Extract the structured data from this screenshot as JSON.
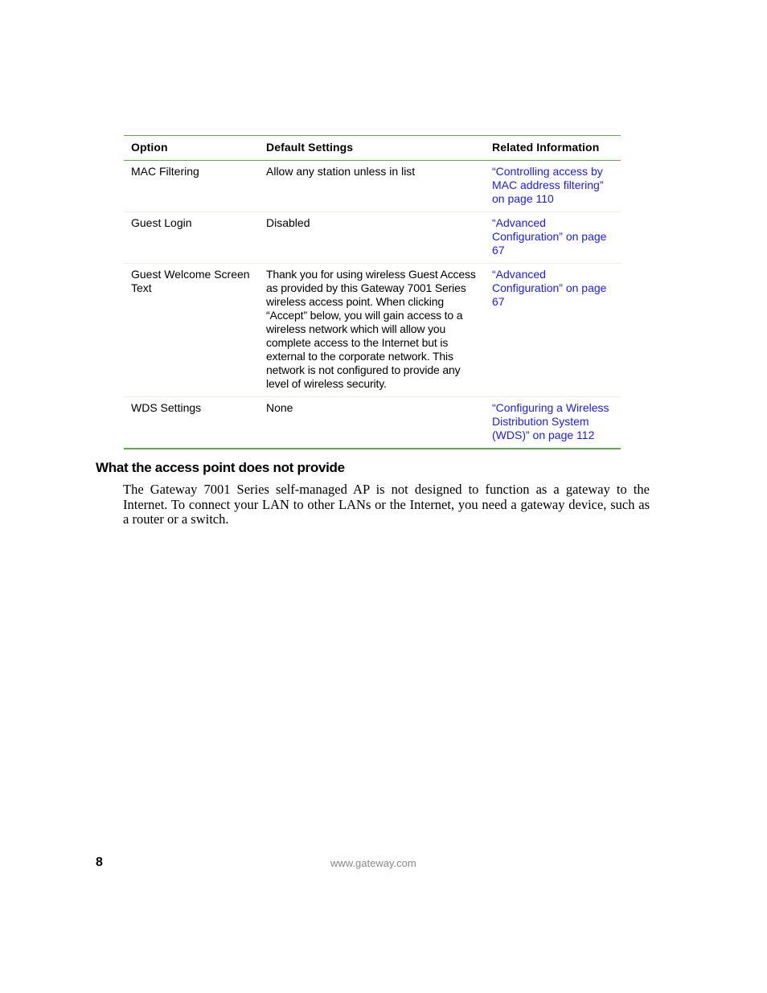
{
  "table": {
    "headers": [
      "Option",
      "Default Settings",
      "Related Information"
    ],
    "rows": [
      {
        "option": "MAC Filtering",
        "default": "Allow any station unless in list",
        "related": "“Controlling access by MAC address filtering” on page 110"
      },
      {
        "option": "Guest Login",
        "default": "Disabled",
        "related": " “Advanced Configuration” on page 67"
      },
      {
        "option": "Guest Welcome Screen Text",
        "default": "Thank you for using wireless Guest Access as provided by this Gateway 7001 Series wireless access point. When clicking “Accept” below, you will gain access to a wireless network which will allow you complete access to the Internet but is external to the corporate network. This network is not configured to provide any level of wireless security.",
        "related": " “Advanced Configuration” on page 67"
      },
      {
        "option": "WDS Settings",
        "default": "None",
        "related": "“Configuring a Wireless Distribution System (WDS)” on page 112"
      }
    ]
  },
  "section": {
    "heading": "What the access point does not provide",
    "body": "The Gateway 7001 Series self-managed AP is not designed to function as a gateway to the Internet. To connect your LAN to other LANs or the Internet, you need a gateway device, such as a router or a switch."
  },
  "footer": {
    "page_number": "8",
    "url": "www.gateway.com"
  },
  "colors": {
    "rule_green": "#5aac4e",
    "link_blue": "#1a1aff"
  }
}
